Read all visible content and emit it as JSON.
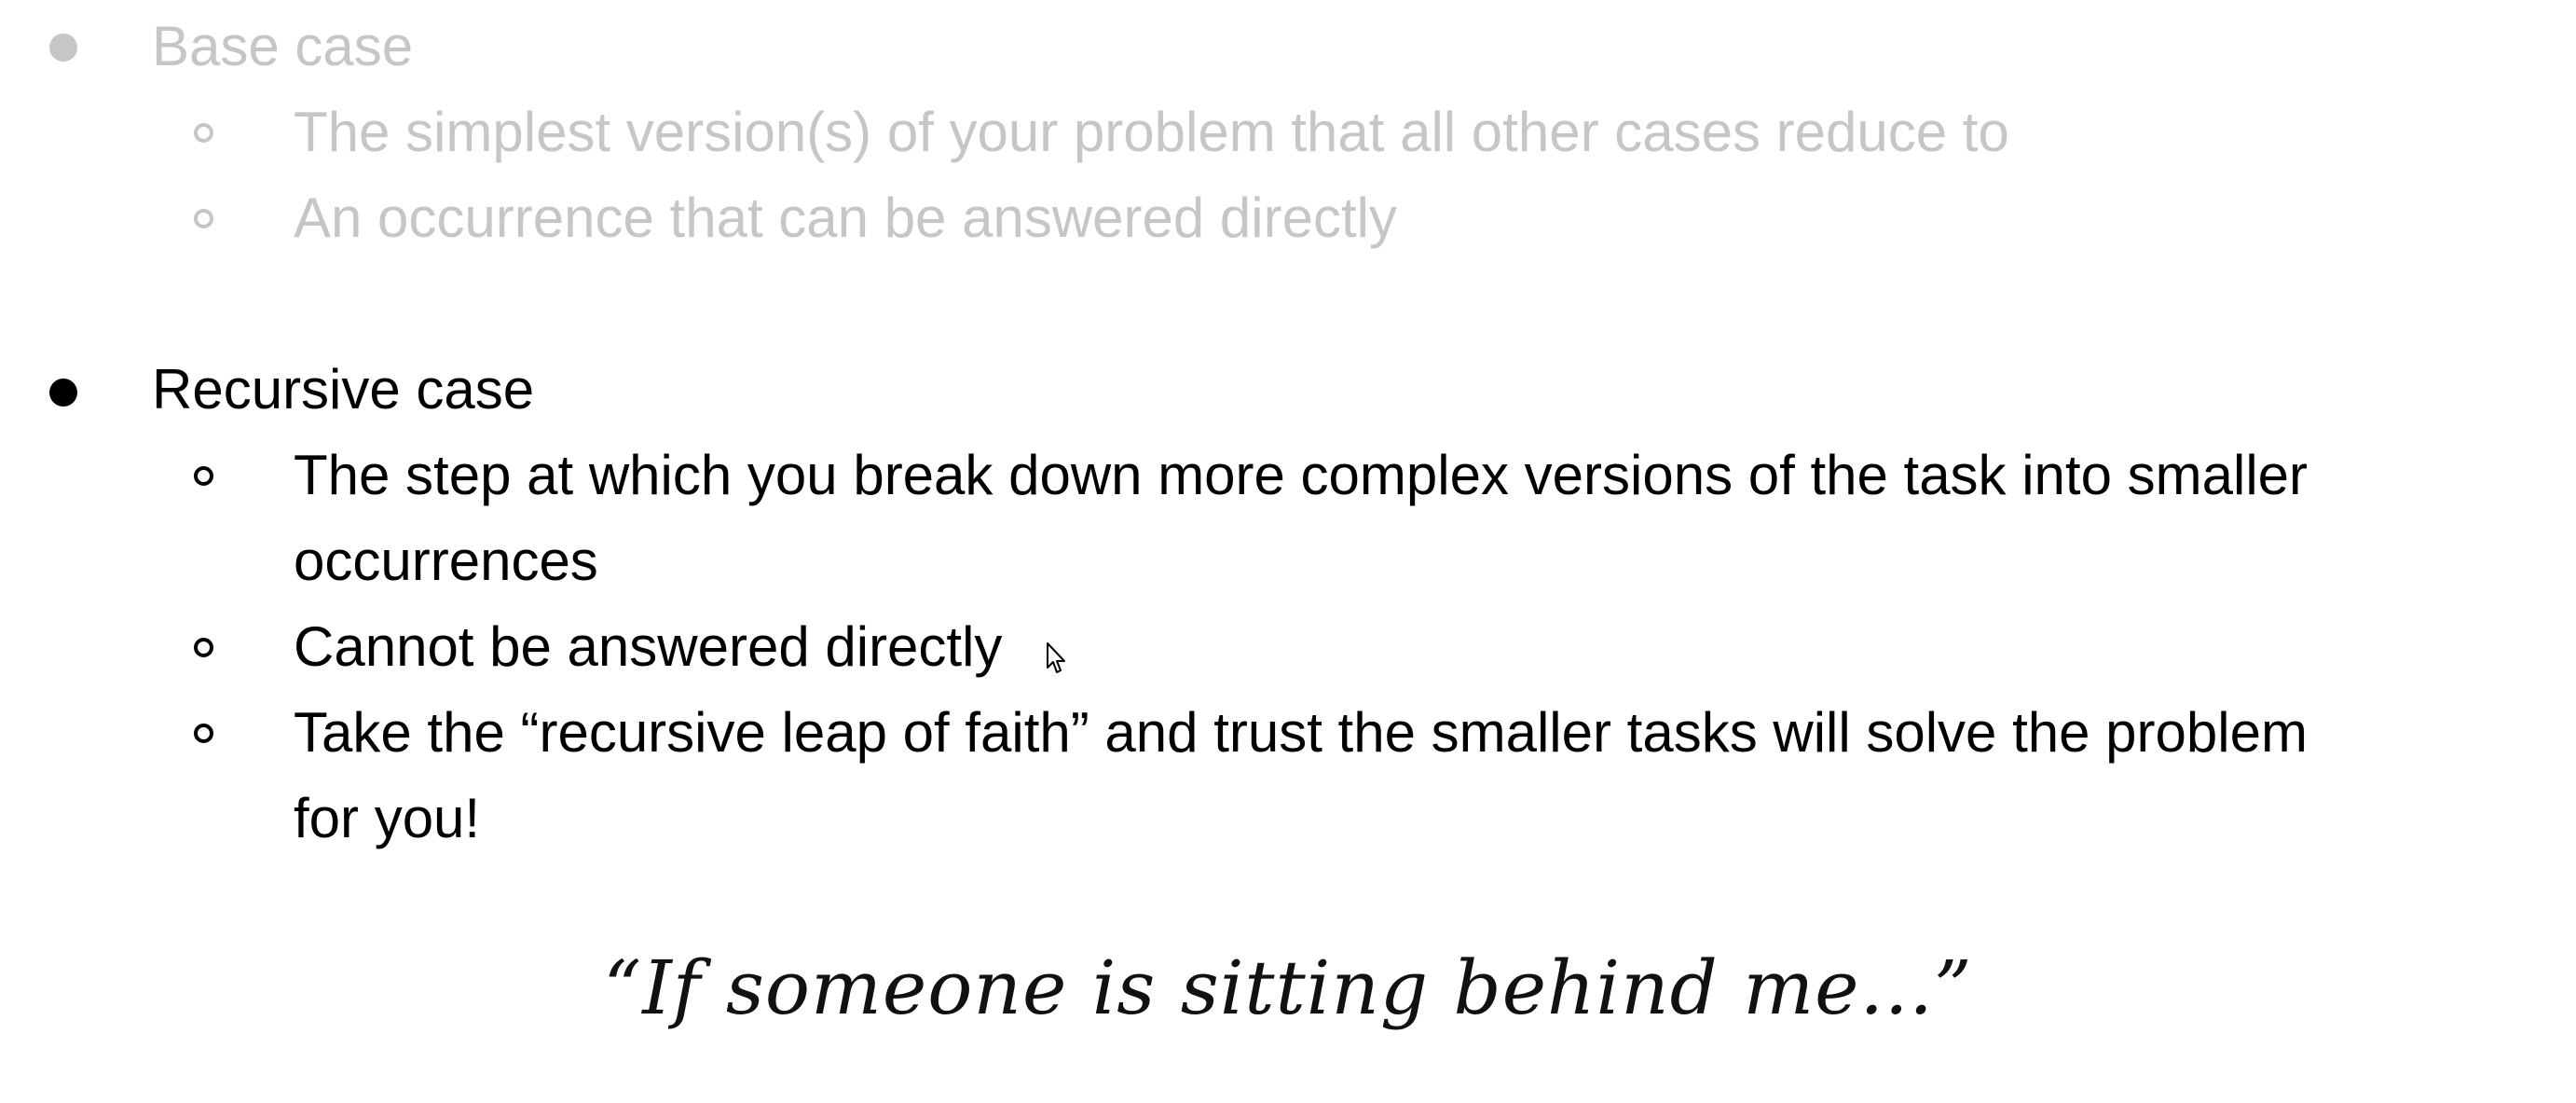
{
  "base_case": {
    "heading": "Base case",
    "items": [
      "The simplest version(s) of your problem that all other cases reduce to",
      "An occurrence that can be answered directly"
    ]
  },
  "recursive_case": {
    "heading": "Recursive case",
    "item1_line1": "The step at which you break down more complex versions of the task into smaller",
    "item1_line2": "occurrences",
    "item2": "Cannot be answered directly",
    "item3_line1": "Take the “recursive leap of faith” and trust the smaller tasks will solve the problem",
    "item3_line2": "for you!"
  },
  "quote": "“If someone is sitting behind me...”",
  "colors": {
    "faded_text": "#c6c6c6",
    "active_text": "#000000"
  },
  "icons": {
    "cursor": "mouse-pointer-icon"
  }
}
